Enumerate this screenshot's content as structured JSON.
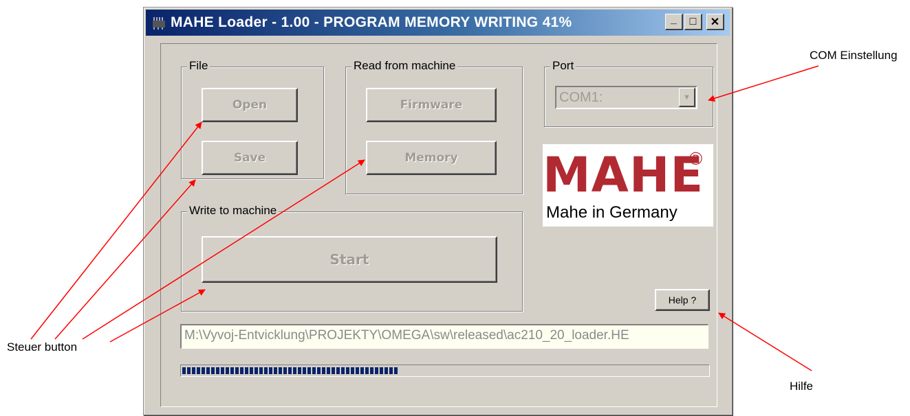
{
  "window": {
    "title": "MAHE Loader - 1.00 - PROGRAM MEMORY WRITING  41%",
    "minimize_label": "_",
    "maximize_label": "□",
    "close_label": "✕"
  },
  "file_group": {
    "label": "File",
    "open_label": "Open",
    "save_label": "Save"
  },
  "read_group": {
    "label": "Read from machine",
    "firmware_label": "Firmware",
    "memory_label": "Memory"
  },
  "port_group": {
    "label": "Port",
    "selected": "COM1:"
  },
  "write_group": {
    "label": "Write to machine",
    "start_label": "Start"
  },
  "logo": {
    "brand": "MAHE",
    "registered": "®",
    "tagline": "Mahe in Germany"
  },
  "help_label": "Help ?",
  "file_path": "M:\\Vyvoj-Entvicklung\\PROJEKTY\\OMEGA\\sw\\released\\ac210_20_loader.HE",
  "progress": {
    "percent": 41
  },
  "annotations": {
    "com": "COM Einstellung",
    "steuer": "Steuer button",
    "hilfe": "Hilfe"
  },
  "colors": {
    "arrow": "#ff0000",
    "titlebar_start": "#0a246a",
    "logo_red": "#b12a32",
    "dialog_face": "#d4d0c8"
  },
  "icons": [
    "app-icon",
    "minimize-icon",
    "maximize-icon",
    "close-icon",
    "dropdown-arrow-icon"
  ]
}
